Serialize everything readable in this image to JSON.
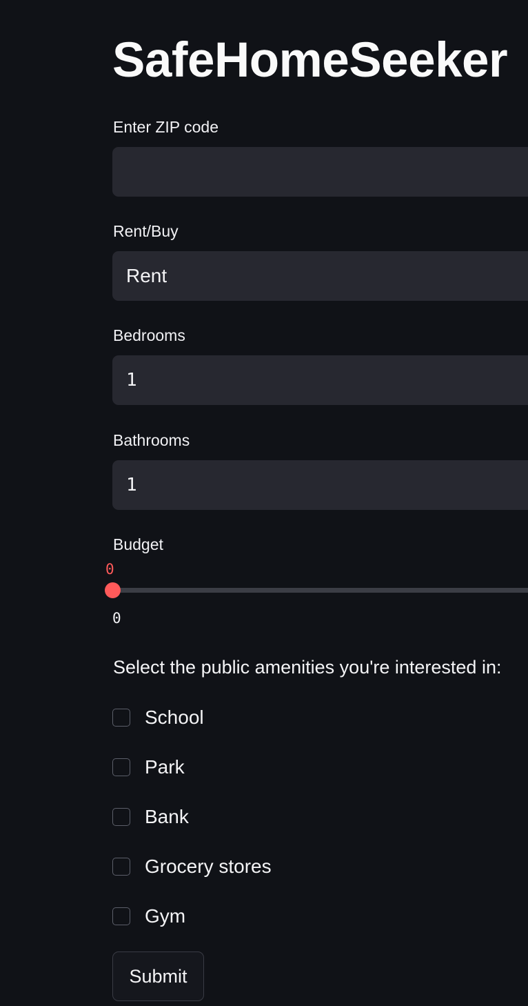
{
  "app": {
    "title": "SafeHomeSeeker"
  },
  "form": {
    "zip": {
      "label": "Enter ZIP code",
      "value": "",
      "placeholder": ""
    },
    "rent_buy": {
      "label": "Rent/Buy",
      "selected": "Rent"
    },
    "bedrooms": {
      "label": "Bedrooms",
      "value": "1"
    },
    "bathrooms": {
      "label": "Bathrooms",
      "value": "1"
    },
    "budget": {
      "label": "Budget",
      "current": "0",
      "min": "0",
      "value": 0
    },
    "amenities": {
      "prompt": "Select the public amenities you're interested in:",
      "options": [
        {
          "label": "School",
          "checked": false
        },
        {
          "label": "Park",
          "checked": false
        },
        {
          "label": "Bank",
          "checked": false
        },
        {
          "label": "Grocery stores",
          "checked": false
        },
        {
          "label": "Gym",
          "checked": false
        }
      ]
    },
    "submit_label": "Submit"
  },
  "colors": {
    "background": "#101217",
    "field": "#272830",
    "accent": "#ff5a5a"
  }
}
